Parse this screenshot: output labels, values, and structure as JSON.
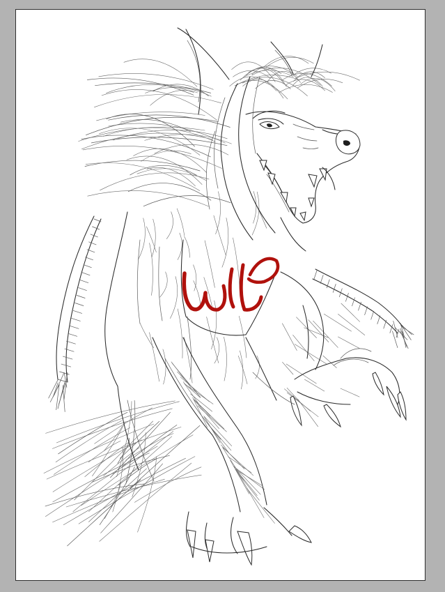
{
  "colors": {
    "workspace_background": "#b3b3b3",
    "canvas_background": "#ffffff",
    "line_art": "#2a2a2a",
    "signature_ink": "#b0110c"
  }
}
